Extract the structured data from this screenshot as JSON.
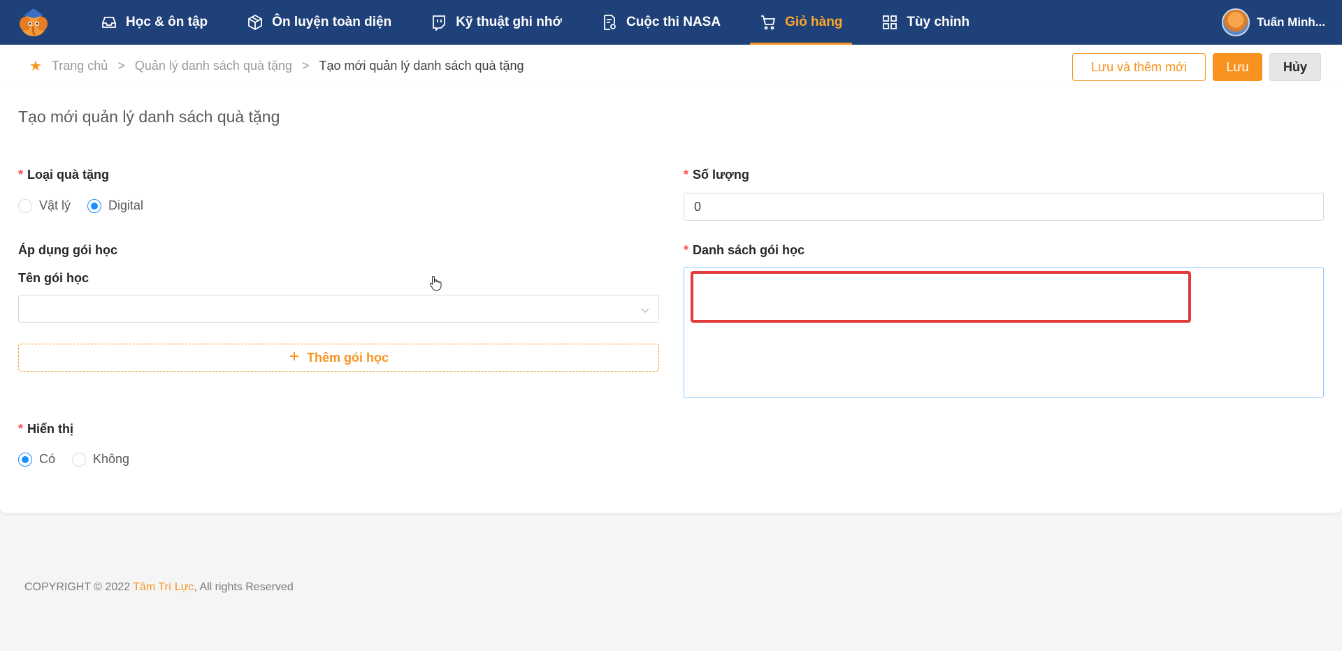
{
  "nav": {
    "items": [
      {
        "label": "Học & ôn tập",
        "icon": "inbox-icon",
        "active": false
      },
      {
        "label": "Ôn luyện toàn diện",
        "icon": "cube-icon",
        "active": false
      },
      {
        "label": "Kỹ thuật ghi nhớ",
        "icon": "chat-brand-icon",
        "active": false
      },
      {
        "label": "Cuộc thi NASA",
        "icon": "document-settings-icon",
        "active": false
      },
      {
        "label": "Giỏ hàng",
        "icon": "cart-icon",
        "active": true
      },
      {
        "label": "Tùy chỉnh",
        "icon": "grid-icon",
        "active": false
      }
    ],
    "user_name": "Tuấn Minh..."
  },
  "breadcrumb": {
    "home": "Trang chủ",
    "parent": "Quản lý danh sách quà tặng",
    "current": "Tạo mới quản lý danh sách quà tặng",
    "separator": ">"
  },
  "actions": {
    "save_and_new": "Lưu và thêm mới",
    "save": "Lưu",
    "cancel": "Hủy"
  },
  "form": {
    "title": "Tạo mới quản lý danh sách quà tặng",
    "required_mark": "*",
    "gift_type": {
      "label": "Loại quà tặng",
      "options": [
        "Vật lý",
        "Digital"
      ],
      "selected": "Digital"
    },
    "quantity": {
      "label": "Số lượng",
      "value": "0"
    },
    "apply_course": {
      "label": "Áp dụng gói học"
    },
    "course_name": {
      "label": "Tên gói học",
      "value": ""
    },
    "add_course": {
      "label": "Thêm gói học",
      "icon": "plus-icon"
    },
    "course_list": {
      "label": "Danh sách gói học",
      "value": ""
    },
    "display": {
      "label": "Hiển thị",
      "options": [
        "Có",
        "Không"
      ],
      "selected": "Có"
    }
  },
  "footer": {
    "prefix": "COPYRIGHT © 2022",
    "brand": "Tâm Trí Lực",
    "suffix": ", All rights Reserved"
  },
  "colors": {
    "nav_bg": "#1f4179",
    "accent": "#f7931e",
    "radio_active": "#1890ff",
    "required": "#ff4d4f",
    "highlight": "#e03a3a"
  }
}
